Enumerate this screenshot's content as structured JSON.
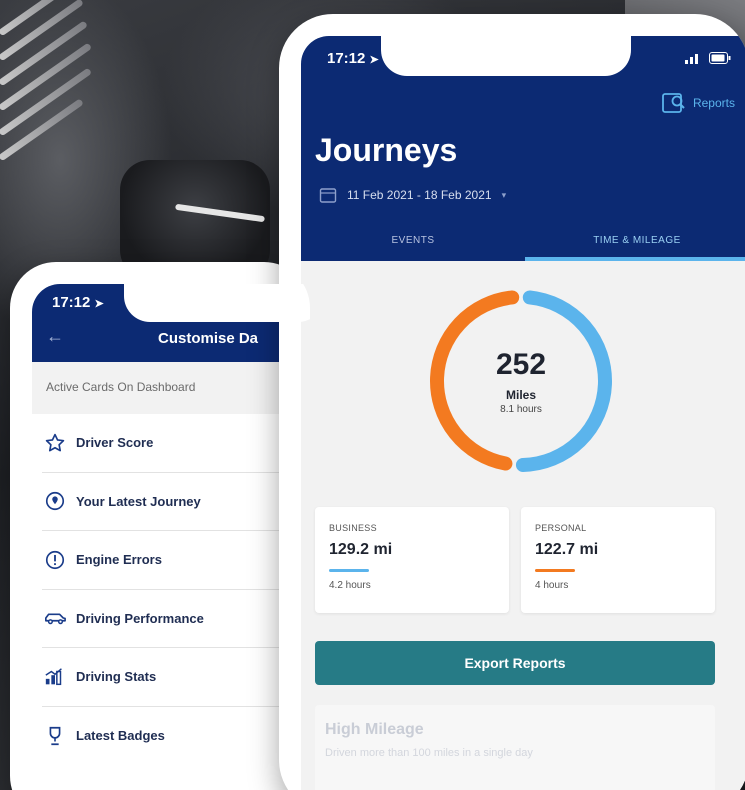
{
  "left_screen": {
    "time": "17:12",
    "title": "Customise Da",
    "section_label": "Active Cards On Dashboard",
    "items": [
      {
        "label": "Driver Score",
        "icon": "star-icon"
      },
      {
        "label": "Your Latest Journey",
        "icon": "location-pin-icon"
      },
      {
        "label": "Engine Errors",
        "icon": "alert-circle-icon"
      },
      {
        "label": "Driving Performance",
        "icon": "car-icon"
      },
      {
        "label": "Driving Stats",
        "icon": "bar-chart-icon"
      },
      {
        "label": "Latest Badges",
        "icon": "trophy-icon"
      }
    ]
  },
  "right_screen": {
    "time": "17:12",
    "reports_label": "Reports",
    "title": "Journeys",
    "date_range": "11 Feb 2021 - 18 Feb 2021",
    "tabs": [
      {
        "label": "EVENTS",
        "active": false
      },
      {
        "label": "TIME & MILEAGE",
        "active": true
      }
    ],
    "summary": {
      "total": "252",
      "unit": "Miles",
      "hours": "8.1 hours",
      "business_fraction": 0.513,
      "personal_fraction": 0.487
    },
    "business": {
      "label": "BUSINESS",
      "value": "129.2 mi",
      "hours": "4.2 hours",
      "color": "#5bb4ec"
    },
    "personal": {
      "label": "PERSONAL",
      "value": "122.7 mi",
      "hours": "4 hours",
      "color": "#f37a20"
    },
    "export_label": "Export Reports",
    "high_mileage": {
      "title": "High Mileage",
      "subtitle": "Driven more than 100 miles in a single day"
    }
  },
  "colors": {
    "header_navy": "#0c2a73",
    "accent_blue": "#5bb4ec",
    "accent_orange": "#f37a20",
    "button_teal": "#267b86"
  }
}
